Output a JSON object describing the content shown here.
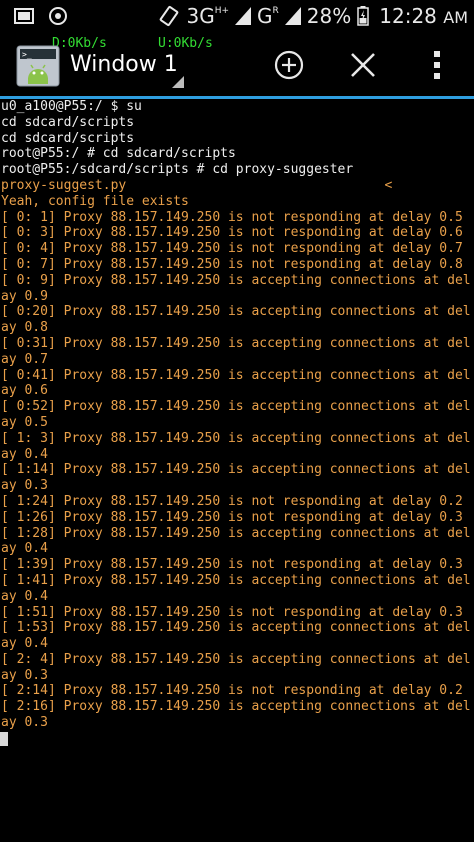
{
  "status_bar": {
    "network_3g": "3G",
    "network_h": "H+",
    "network_g": "G",
    "network_r": "R",
    "battery": "28%",
    "time": "12:28",
    "time_suffix": "AM",
    "icons": [
      "screenshot-icon",
      "android-debug-icon",
      "rotate-icon",
      "signal-icon",
      "signal-icon",
      "battery-icon"
    ]
  },
  "app_bar": {
    "download_speed": "D:0Kb/s",
    "upload_speed": "U:0Kb/s",
    "window_title": "Window 1",
    "icons": [
      "terminal-app-icon",
      "add-window-icon",
      "close-window-icon",
      "overflow-menu-icon"
    ],
    "accent_color": "#2f9fe0"
  },
  "terminal": {
    "text_color": "#eeeeee",
    "output_color": "#e9a04a",
    "lines": [
      {
        "text": "u0_a100@P55:/ $ su",
        "kind": "white"
      },
      {
        "text": "cd sdcard/scripts",
        "kind": "white"
      },
      {
        "text": "cd sdcard/scripts",
        "kind": "white"
      },
      {
        "text": "root@P55:/ # cd sdcard/scripts",
        "kind": "white"
      },
      {
        "text": "root@P55:/sdcard/scripts # cd proxy-suggester",
        "kind": "white"
      },
      {
        "text": "proxy-suggest.py                                 <",
        "kind": "orange"
      },
      {
        "text": "Yeah, config file exists",
        "kind": "orange"
      },
      {
        "text": "[ 0: 1] Proxy 88.157.149.250 is not responding at delay 0.5",
        "kind": "orange"
      },
      {
        "text": "[ 0: 3] Proxy 88.157.149.250 is not responding at delay 0.6",
        "kind": "orange"
      },
      {
        "text": "[ 0: 4] Proxy 88.157.149.250 is not responding at delay 0.7",
        "kind": "orange"
      },
      {
        "text": "[ 0: 7] Proxy 88.157.149.250 is not responding at delay 0.8",
        "kind": "orange"
      },
      {
        "text": "[ 0: 9] Proxy 88.157.149.250 is accepting connections at del",
        "kind": "orange"
      },
      {
        "text": "ay 0.9",
        "kind": "orange"
      },
      {
        "text": "[ 0:20] Proxy 88.157.149.250 is accepting connections at del",
        "kind": "orange"
      },
      {
        "text": "ay 0.8",
        "kind": "orange"
      },
      {
        "text": "[ 0:31] Proxy 88.157.149.250 is accepting connections at del",
        "kind": "orange"
      },
      {
        "text": "ay 0.7",
        "kind": "orange"
      },
      {
        "text": "[ 0:41] Proxy 88.157.149.250 is accepting connections at del",
        "kind": "orange"
      },
      {
        "text": "ay 0.6",
        "kind": "orange"
      },
      {
        "text": "[ 0:52] Proxy 88.157.149.250 is accepting connections at del",
        "kind": "orange"
      },
      {
        "text": "ay 0.5",
        "kind": "orange"
      },
      {
        "text": "[ 1: 3] Proxy 88.157.149.250 is accepting connections at del",
        "kind": "orange"
      },
      {
        "text": "ay 0.4",
        "kind": "orange"
      },
      {
        "text": "[ 1:14] Proxy 88.157.149.250 is accepting connections at del",
        "kind": "orange"
      },
      {
        "text": "ay 0.3",
        "kind": "orange"
      },
      {
        "text": "[ 1:24] Proxy 88.157.149.250 is not responding at delay 0.2",
        "kind": "orange"
      },
      {
        "text": "[ 1:26] Proxy 88.157.149.250 is not responding at delay 0.3",
        "kind": "orange"
      },
      {
        "text": "[ 1:28] Proxy 88.157.149.250 is accepting connections at del",
        "kind": "orange"
      },
      {
        "text": "ay 0.4",
        "kind": "orange"
      },
      {
        "text": "[ 1:39] Proxy 88.157.149.250 is not responding at delay 0.3",
        "kind": "orange"
      },
      {
        "text": "[ 1:41] Proxy 88.157.149.250 is accepting connections at del",
        "kind": "orange"
      },
      {
        "text": "ay 0.4",
        "kind": "orange"
      },
      {
        "text": "[ 1:51] Proxy 88.157.149.250 is not responding at delay 0.3",
        "kind": "orange"
      },
      {
        "text": "[ 1:53] Proxy 88.157.149.250 is accepting connections at del",
        "kind": "orange"
      },
      {
        "text": "ay 0.4",
        "kind": "orange"
      },
      {
        "text": "[ 2: 4] Proxy 88.157.149.250 is accepting connections at del",
        "kind": "orange"
      },
      {
        "text": "ay 0.3",
        "kind": "orange"
      },
      {
        "text": "[ 2:14] Proxy 88.157.149.250 is not responding at delay 0.2",
        "kind": "orange"
      },
      {
        "text": "[ 2:16] Proxy 88.157.149.250 is accepting connections at del",
        "kind": "orange"
      },
      {
        "text": "ay 0.3",
        "kind": "orange"
      }
    ]
  }
}
